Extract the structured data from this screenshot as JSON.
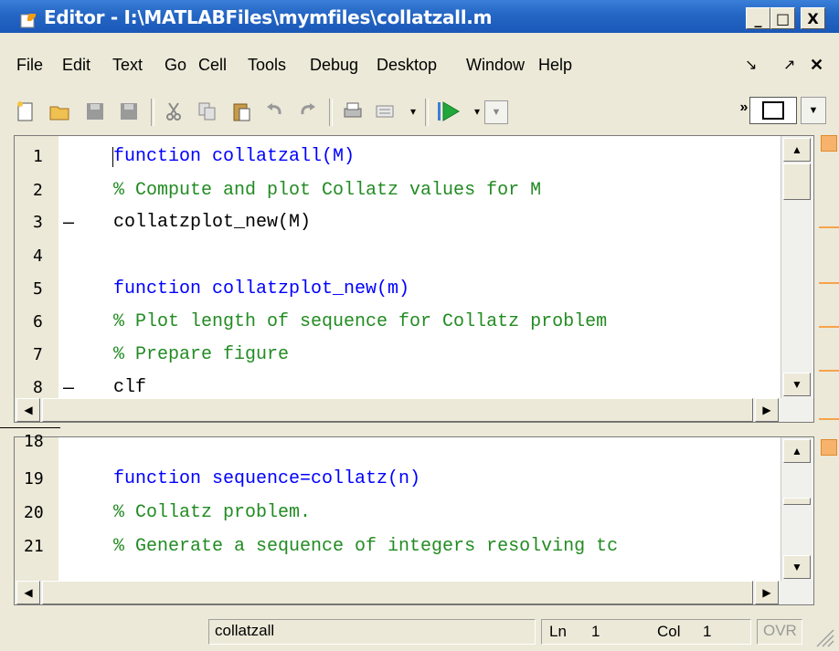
{
  "window": {
    "title": "Editor - I:\\MATLABFiles\\mymfiles\\collatzall.m",
    "minimize": "_",
    "maximize": "□",
    "close": "X"
  },
  "menubar": {
    "items": [
      "File",
      "Edit",
      "Text",
      "Go",
      "Cell",
      "Tools",
      "Debug",
      "Desktop",
      "Window",
      "Help"
    ],
    "dock_glyph": "↘",
    "undock_glyph": "↗",
    "close_glyph": "✕"
  },
  "editor_top": {
    "lines": [
      {
        "num": "1",
        "dash": false,
        "text": "function collatzall(M)",
        "kind": "kw"
      },
      {
        "num": "2",
        "dash": false,
        "text": "% Compute and plot Collatz values for M",
        "kind": "cm"
      },
      {
        "num": "3",
        "dash": true,
        "text": "collatzplot_new(M)",
        "kind": "code"
      },
      {
        "num": "4",
        "dash": false,
        "text": "",
        "kind": "code"
      },
      {
        "num": "5",
        "dash": false,
        "text": "function collatzplot_new(m)",
        "kind": "kw"
      },
      {
        "num": "6",
        "dash": false,
        "text": "% Plot length of sequence for Collatz problem",
        "kind": "cm"
      },
      {
        "num": "7",
        "dash": false,
        "text": "% Prepare figure",
        "kind": "cm"
      },
      {
        "num": "8",
        "dash": true,
        "text": "clf",
        "kind": "code"
      }
    ]
  },
  "editor_bottom": {
    "lines": [
      {
        "num": "18",
        "dash": false,
        "text": "",
        "kind": "code"
      },
      {
        "num": "19",
        "dash": false,
        "text": "function sequence=collatz(n)",
        "kind": "kw"
      },
      {
        "num": "20",
        "dash": false,
        "text": "% Collatz problem.",
        "kind": "cm"
      },
      {
        "num": "21",
        "dash": false,
        "text": "% Generate a sequence of integers resolving tc",
        "kind": "cm"
      }
    ]
  },
  "status": {
    "function_name": "collatzall",
    "ln_label": "Ln",
    "ln_value": "1",
    "col_label": "Col",
    "col_value": "1",
    "ovr": "OVR"
  },
  "colors": {
    "keyword": "#0000ff",
    "comment": "#228b22",
    "titlebar": "#2466c4"
  }
}
